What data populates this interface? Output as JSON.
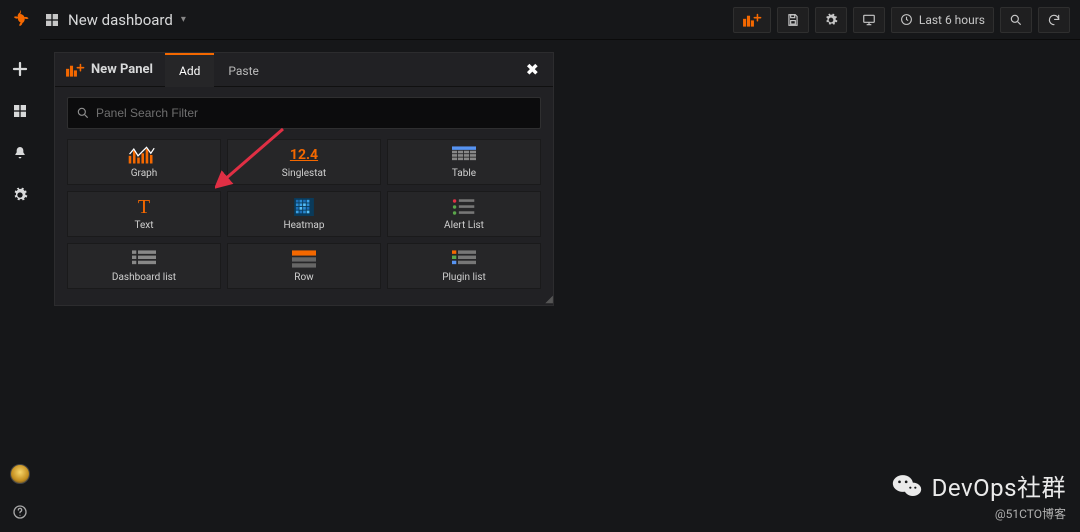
{
  "header": {
    "title": "New dashboard",
    "timerange_label": "Last 6 hours"
  },
  "add_panel": {
    "panel_label": "New Panel",
    "tab_add": "Add",
    "tab_paste": "Paste",
    "search_placeholder": "Panel Search Filter",
    "tiles": {
      "graph": "Graph",
      "singlestat": "Singlestat",
      "singlestat_value": "12.4",
      "table": "Table",
      "text": "Text",
      "heatmap": "Heatmap",
      "alertlist": "Alert List",
      "dashboardlist": "Dashboard list",
      "row": "Row",
      "pluginlist": "Plugin list"
    }
  },
  "watermark": {
    "title": "DevOps社群",
    "subtitle": "@51CTO博客"
  }
}
